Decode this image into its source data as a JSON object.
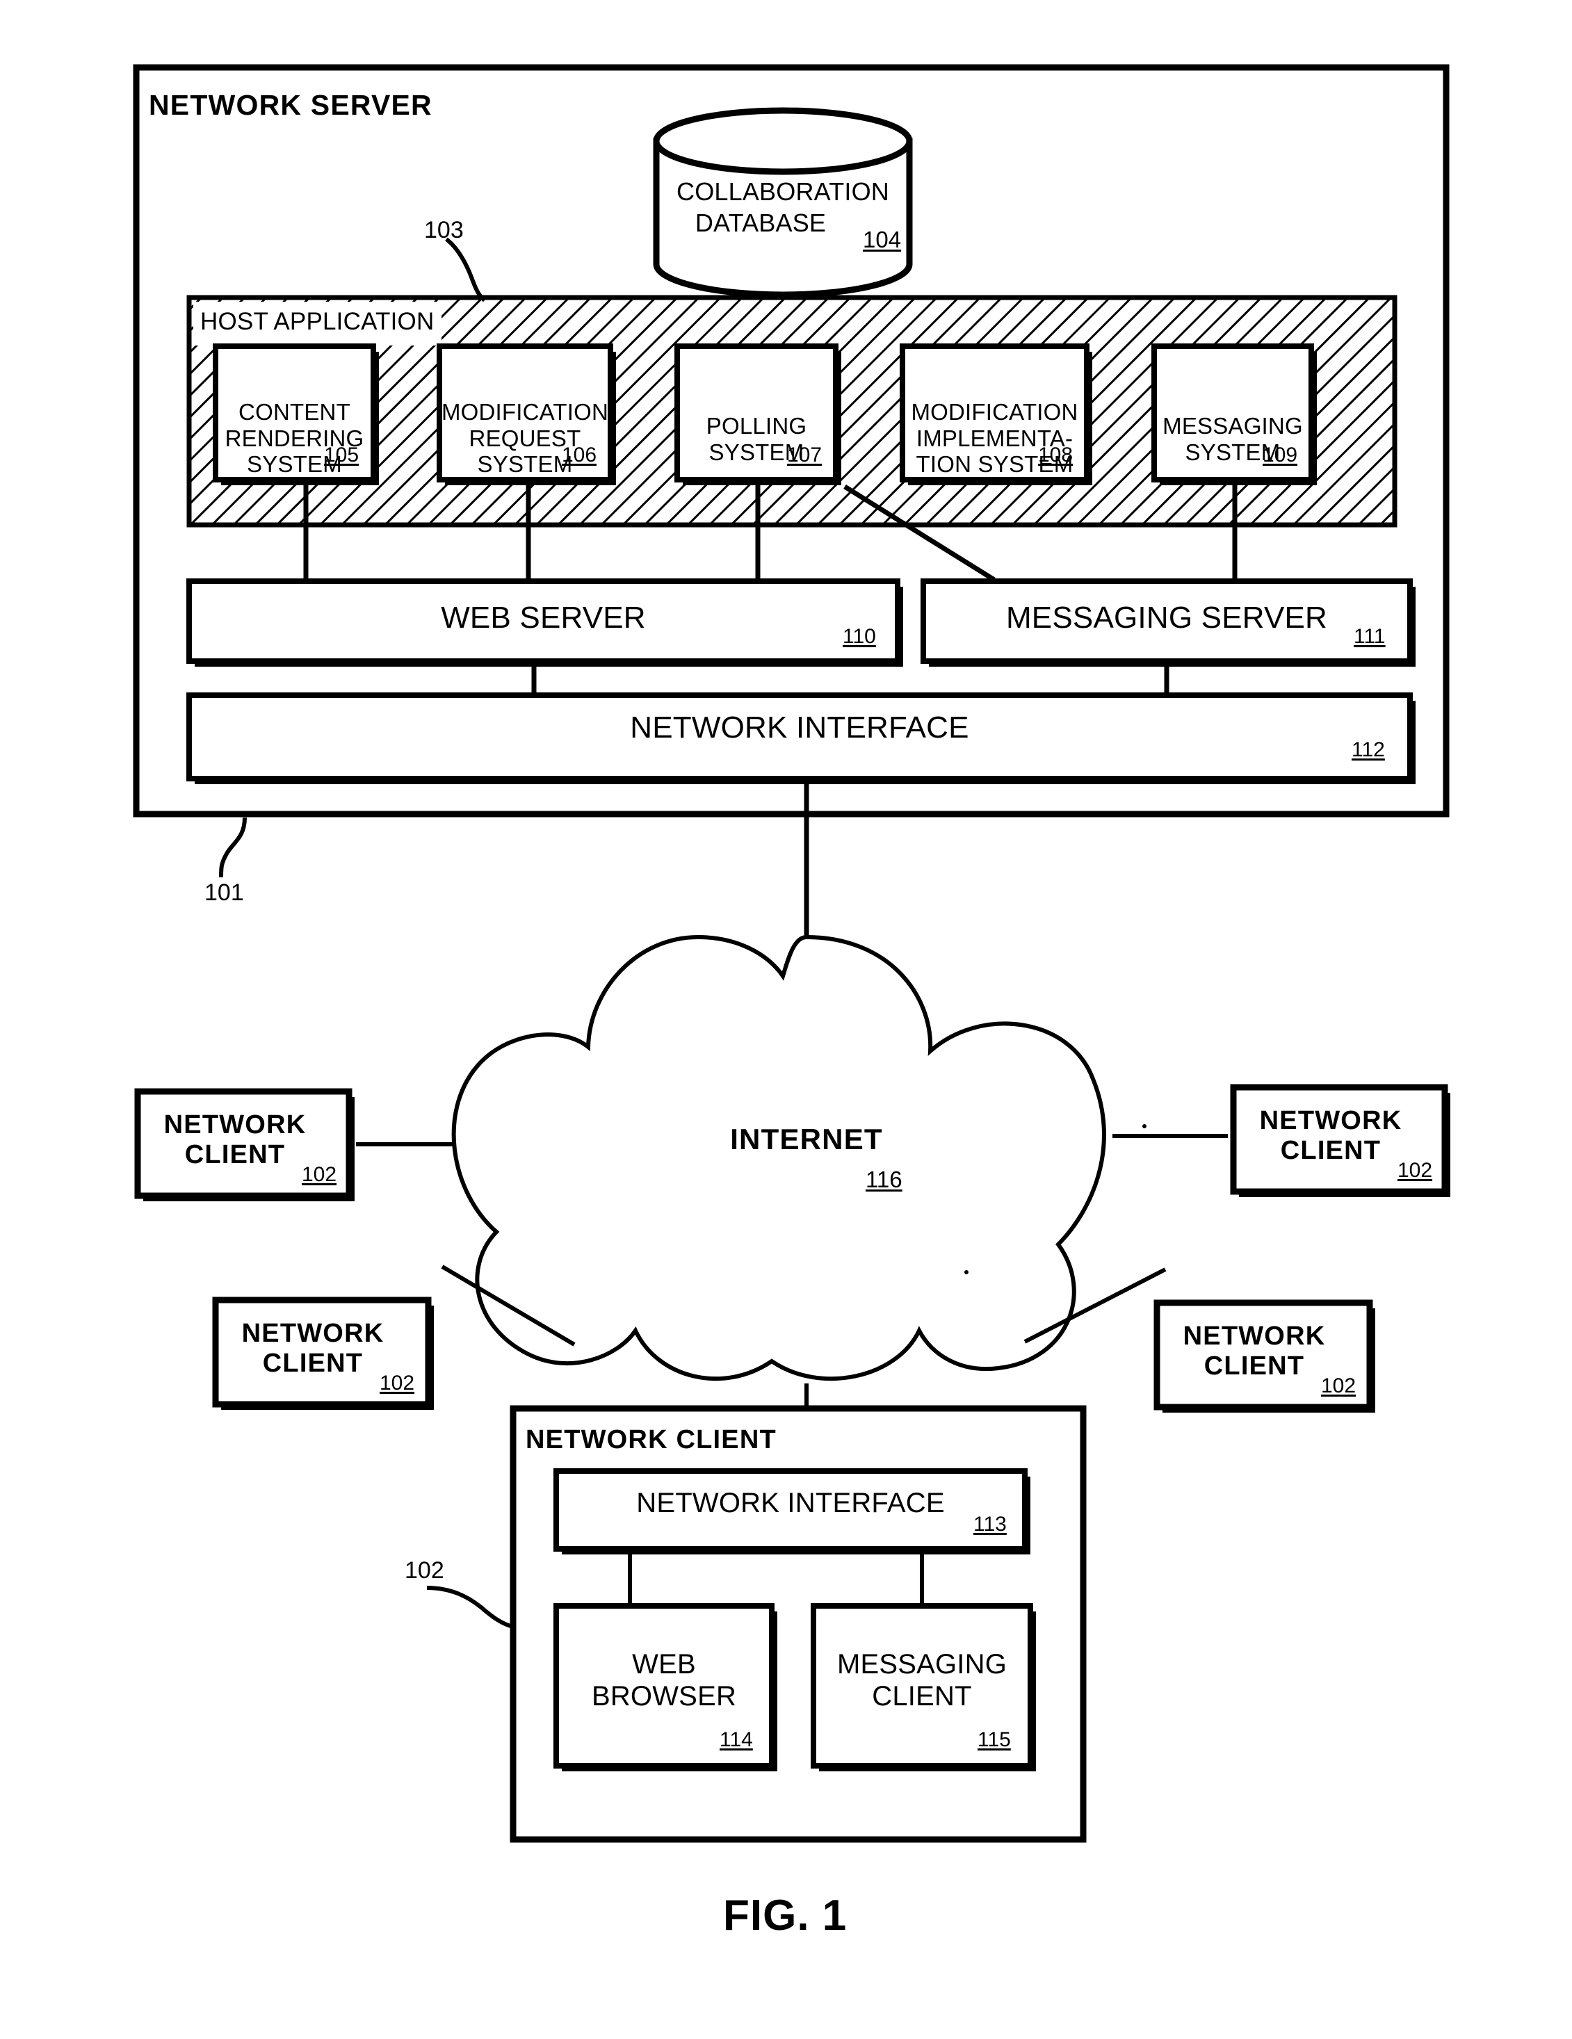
{
  "figure": {
    "caption": "FIG. 1"
  },
  "server": {
    "title": "NETWORK  SERVER",
    "ref": "101"
  },
  "database": {
    "line1": "COLLABORATION",
    "line2": "DATABASE",
    "ref": "104"
  },
  "host_application": {
    "label": "HOST APPLICATION",
    "ref": "103",
    "systems": [
      {
        "label": "CONTENT\nRENDERING\nSYSTEM",
        "ref": "105"
      },
      {
        "label": "MODIFICATION\nREQUEST\nSYSTEM",
        "ref": "106"
      },
      {
        "label": "POLLING\nSYSTEM",
        "ref": "107"
      },
      {
        "label": "MODIFICATION\nIMPLEMENTA-\nTION SYSTEM",
        "ref": "108"
      },
      {
        "label": "MESSAGING\nSYSTEM",
        "ref": "109"
      }
    ]
  },
  "servers_row": [
    {
      "label": "WEB SERVER",
      "ref": "110"
    },
    {
      "label": "MESSAGING SERVER",
      "ref": "111"
    }
  ],
  "server_network_interface": {
    "label": "NETWORK INTERFACE",
    "ref": "112"
  },
  "internet": {
    "label": "INTERNET",
    "ref": "116"
  },
  "clients": [
    {
      "label": "NETWORK\nCLIENT",
      "ref": "102",
      "position": "left-upper"
    },
    {
      "label": "NETWORK\nCLIENT",
      "ref": "102",
      "position": "right-upper"
    },
    {
      "label": "NETWORK\nCLIENT",
      "ref": "102",
      "position": "left-lower"
    },
    {
      "label": "NETWORK\nCLIENT",
      "ref": "102",
      "position": "right-lower"
    }
  ],
  "client_detail": {
    "title": "NETWORK CLIENT",
    "ref": "102",
    "network_interface": {
      "label": "NETWORK INTERFACE",
      "ref": "113"
    },
    "modules": [
      {
        "label": "WEB\nBROWSER",
        "ref": "114"
      },
      {
        "label": "MESSAGING\nCLIENT",
        "ref": "115"
      }
    ]
  },
  "colors": {
    "ink": "#000000",
    "paper": "#ffffff"
  }
}
